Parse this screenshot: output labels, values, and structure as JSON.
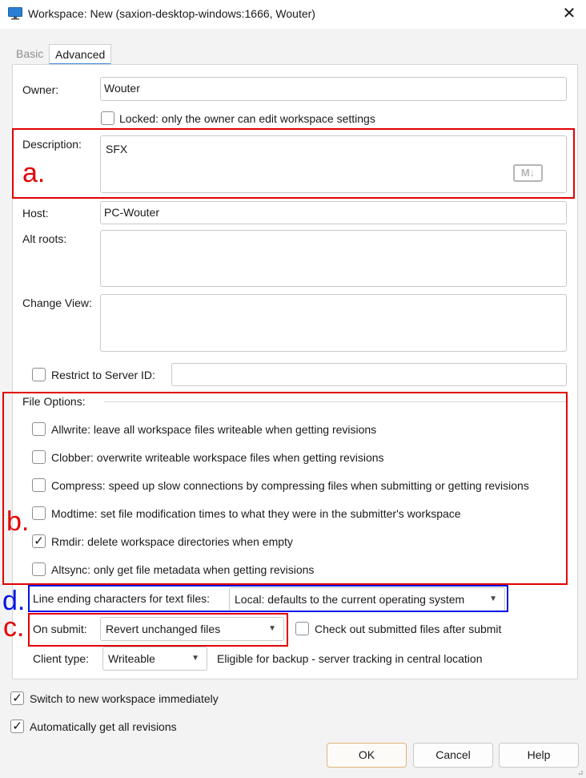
{
  "window": {
    "title": "Workspace: New (saxion-desktop-windows:1666,  Wouter)",
    "close_glyph": "✕"
  },
  "tabs": [
    {
      "label": "Basic",
      "selected": false
    },
    {
      "label": "Advanced",
      "selected": true
    }
  ],
  "form": {
    "owner_label": "Owner:",
    "owner_value": "Wouter",
    "locked_label": "Locked: only the owner can edit workspace settings",
    "locked_checked": false,
    "description_label": "Description:",
    "description_value": "SFX",
    "markdown_badge": "M↓",
    "host_label": "Host:",
    "host_value": "PC-Wouter",
    "altroots_label": "Alt roots:",
    "altroots_value": "",
    "changeview_label": "Change View:",
    "changeview_value": "",
    "restrict_label": "Restrict to Server ID:",
    "restrict_checked": false,
    "restrict_value": ""
  },
  "file_options": {
    "heading": "File Options:",
    "items": [
      {
        "label": "Allwrite: leave all workspace files writeable when getting revisions",
        "checked": false
      },
      {
        "label": "Clobber: overwrite writeable workspace files when getting revisions",
        "checked": false
      },
      {
        "label": "Compress: speed up slow connections by compressing files when submitting or getting revisions",
        "checked": false
      },
      {
        "label": "Modtime: set file modification times to what they were in the submitter's workspace",
        "checked": false
      },
      {
        "label": "Rmdir: delete workspace directories when empty",
        "checked": true
      },
      {
        "label": "Altsync: only get file metadata when getting revisions",
        "checked": false
      }
    ]
  },
  "line_ending": {
    "label": "Line ending characters for text files:",
    "value": "Local: defaults to the current operating system"
  },
  "on_submit": {
    "label": "On submit:",
    "value": "Revert unchanged files",
    "checkout_label": "Check out submitted files after submit",
    "checkout_checked": false
  },
  "client_type": {
    "label": "Client type:",
    "value": "Writeable",
    "note": "Eligible for backup - server tracking in central location"
  },
  "bottom": {
    "switch_label": "Switch to new workspace immediately",
    "switch_checked": true,
    "autoget_label": "Automatically get all revisions",
    "autoget_checked": true
  },
  "buttons": {
    "ok": "OK",
    "cancel": "Cancel",
    "help": "Help"
  },
  "annotations": {
    "a": "a.",
    "b": "b.",
    "c": "c.",
    "d": "d.",
    "red": "#e30000",
    "blue": "#0014e6"
  },
  "glyphs": {
    "check": "✓",
    "dropdown": "▼"
  }
}
